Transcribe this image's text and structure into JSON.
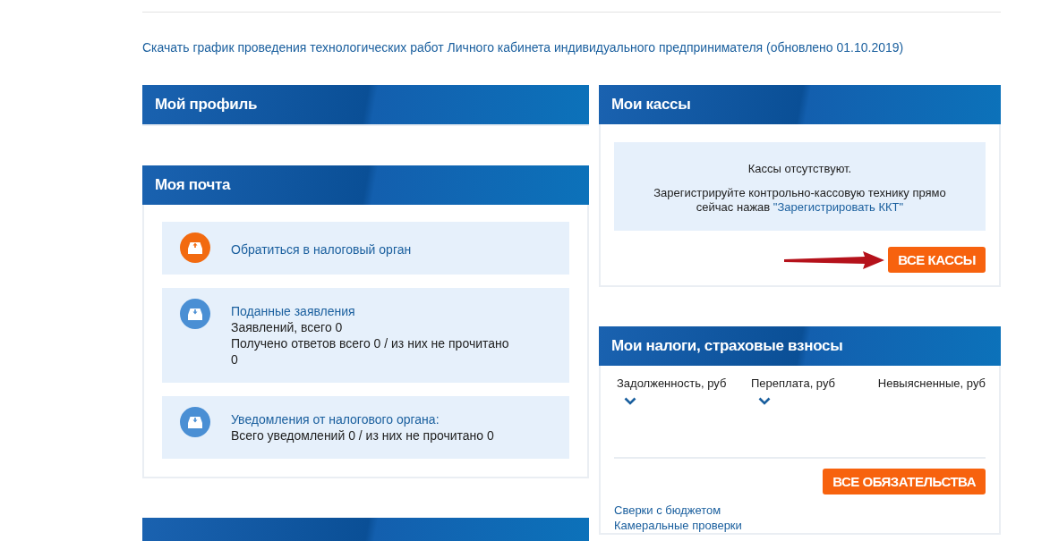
{
  "download_link": "Скачать график проведения технологических работ Личного кабинета индивидуального предпринимателя (обновлено 01.10.2019)",
  "profile": {
    "title": "Мой профиль"
  },
  "mail": {
    "title": "Моя почта",
    "items": [
      {
        "kind": "outgoing",
        "link": "Обратиться в налоговый орган"
      },
      {
        "kind": "incoming",
        "link": "Поданные заявления",
        "lines": [
          "Заявлений, всего 0",
          "Получено ответов всего 0 / из них не прочитано 0"
        ]
      },
      {
        "kind": "incoming",
        "link": "Уведомления от налогового органа:",
        "lines": [
          "Всего уведомлений 0 / из них не прочитано 0"
        ]
      }
    ]
  },
  "registers": {
    "title": "Мои кассы",
    "empty": "Кассы отсутствуют.",
    "hint": "Зарегистрируйте контрольно-кассовую технику прямо сейчас нажав",
    "hint_link": "\"Зарегистрировать ККТ\"",
    "button": "ВСЕ КАССЫ"
  },
  "taxes": {
    "title": "Мои налоги, страховые взносы",
    "columns": [
      {
        "label": "Задолженность, руб",
        "expandable": true
      },
      {
        "label": "Переплата, руб",
        "expandable": true
      },
      {
        "label": "Невыясненные, руб",
        "expandable": false
      }
    ],
    "button": "ВСЕ ОБЯЗАТЕЛЬСТВА",
    "links": [
      "Сверки с бюджетом",
      "Камеральные проверки"
    ]
  }
}
